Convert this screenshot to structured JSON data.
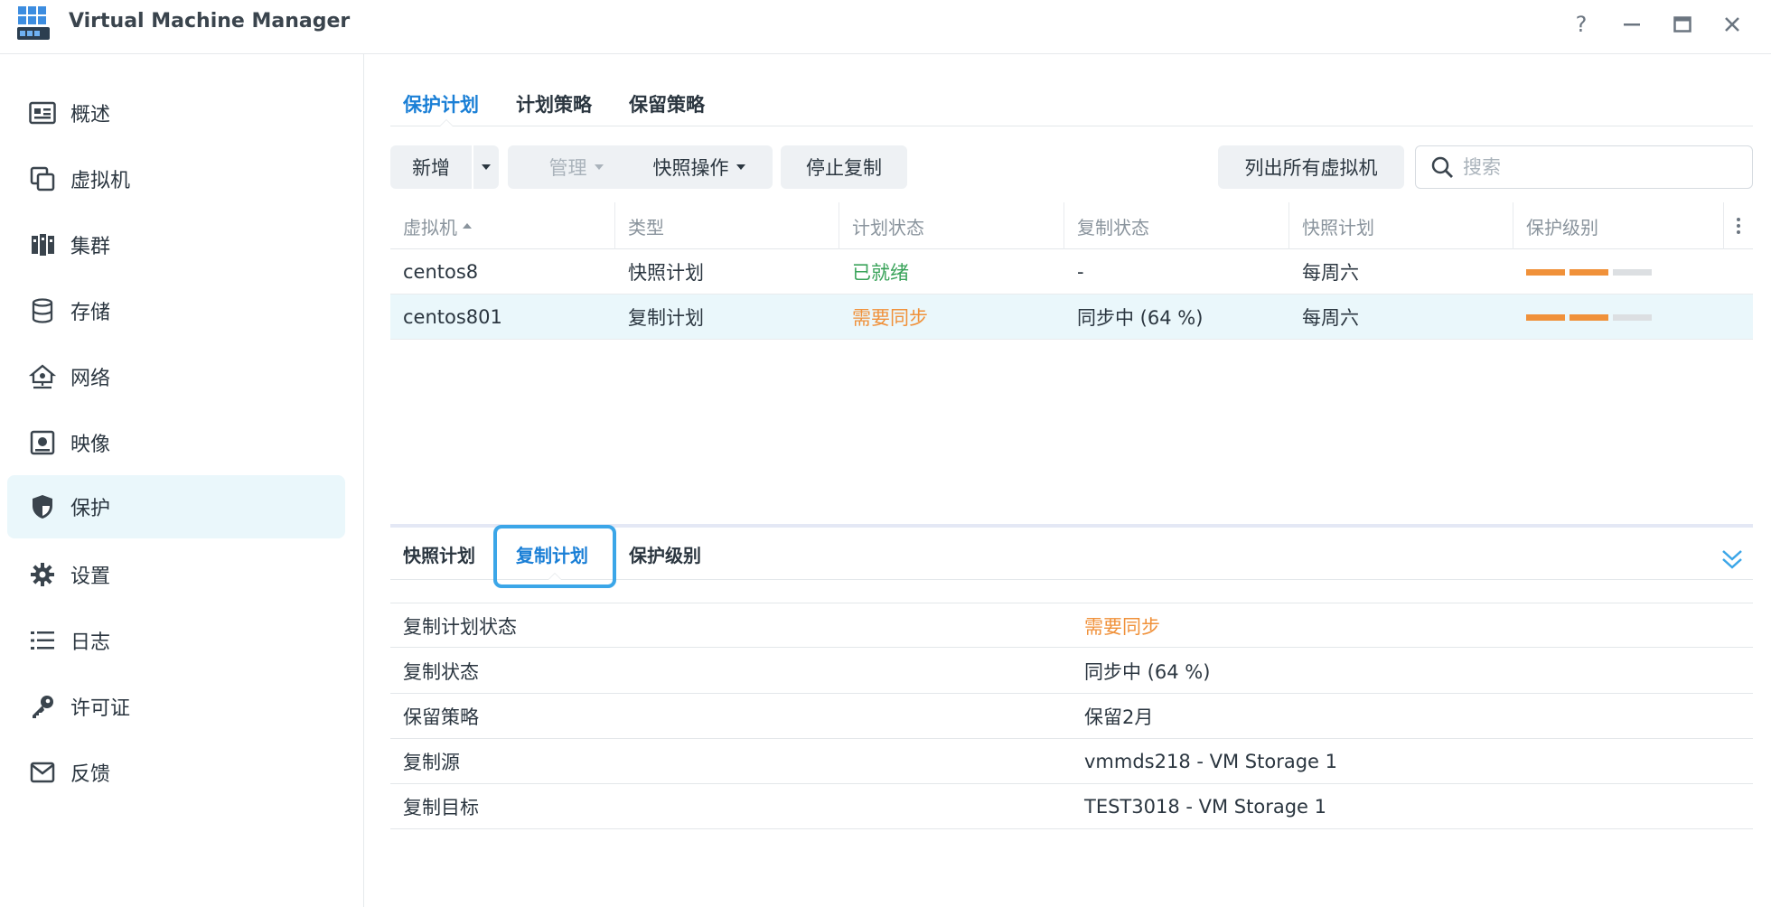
{
  "app": {
    "title": "Virtual Machine Manager"
  },
  "window_controls": {
    "help": "?",
    "minimize": "–",
    "maximize": "▭",
    "close": "✕"
  },
  "sidebar": {
    "items": [
      {
        "label": "概述",
        "icon": "overview-icon"
      },
      {
        "label": "虚拟机",
        "icon": "virtual-machine-icon"
      },
      {
        "label": "集群",
        "icon": "cluster-icon"
      },
      {
        "label": "存储",
        "icon": "storage-icon"
      },
      {
        "label": "网络",
        "icon": "network-icon"
      },
      {
        "label": "映像",
        "icon": "image-icon"
      },
      {
        "label": "保护",
        "icon": "shield-icon",
        "active": true
      },
      {
        "label": "设置",
        "icon": "gear-icon"
      },
      {
        "label": "日志",
        "icon": "log-list-icon"
      },
      {
        "label": "许可证",
        "icon": "key-icon"
      },
      {
        "label": "反馈",
        "icon": "mail-icon"
      }
    ]
  },
  "top_tabs": [
    "保护计划",
    "计划策略",
    "保留策略"
  ],
  "toolbar": {
    "add": "新增",
    "manage": "管理",
    "snapshot_ops": "快照操作",
    "stop_replication": "停止复制",
    "list_all_vms": "列出所有虚拟机",
    "search_placeholder": "搜索"
  },
  "table": {
    "columns": [
      "虚拟机",
      "类型",
      "计划状态",
      "复制状态",
      "快照计划",
      "保护级别"
    ],
    "rows": [
      {
        "vm": "centos8",
        "type": "快照计划",
        "plan_status": "已就绪",
        "plan_status_color": "#3aa35a",
        "replication_status": "-",
        "snapshot_plan": "每周六",
        "protection_level": 2,
        "protection_max": 3
      },
      {
        "vm": "centos801",
        "type": "复制计划",
        "plan_status": "需要同步",
        "plan_status_color": "#f0913a",
        "replication_status": "同步中 (64 %)",
        "snapshot_plan": "每周六",
        "protection_level": 2,
        "protection_max": 3,
        "selected": true
      }
    ]
  },
  "detail": {
    "tabs": [
      "快照计划",
      "复制计划",
      "保护级别"
    ],
    "active_tab": "复制计划",
    "rows": [
      {
        "key": "复制计划状态",
        "value": "需要同步",
        "color": "#f0913a"
      },
      {
        "key": "复制状态",
        "value": "同步中 (64 %)"
      },
      {
        "key": "保留策略",
        "value": "保留2月"
      },
      {
        "key": "复制源",
        "value": "vmmds218 - VM Storage 1"
      },
      {
        "key": "复制目标",
        "value": "TEST3018 - VM Storage 1"
      }
    ]
  },
  "colors": {
    "accent": "#1a7fd6",
    "ready": "#3aa35a",
    "warning": "#f0913a",
    "selection": "#eaf7fb"
  }
}
